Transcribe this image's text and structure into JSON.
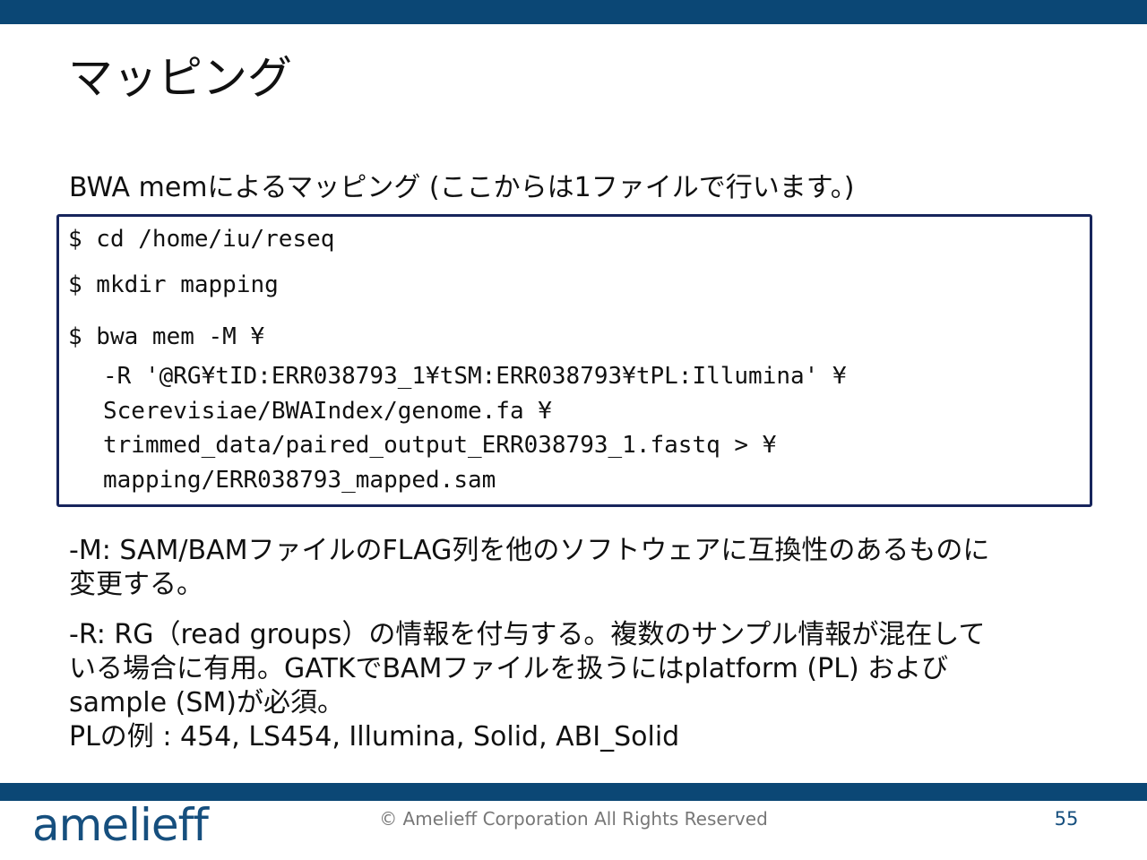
{
  "slide": {
    "title": "マッピング",
    "subtitle": "BWA memによるマッピング (ここからは1ファイルで行います。)"
  },
  "code": {
    "lines": [
      "$ cd /home/iu/reseq",
      "$ mkdir mapping",
      "$ bwa mem -M ¥"
    ],
    "continuation": [
      "-R '@RG¥tID:ERR038793_1¥tSM:ERR038793¥tPL:Illumina' ¥",
      "Scerevisiae/BWAIndex/genome.fa ¥",
      "trimmed_data/paired_output_ERR038793_1.fastq > ¥",
      "mapping/ERR038793_mapped.sam"
    ]
  },
  "notes": {
    "m_option": [
      "-M: SAM/BAMファイルのFLAG列を他のソフトウェアに互換性のあるものに",
      "変更する。"
    ],
    "r_option": [
      "-R: RG（read groups）の情報を付与する。複数のサンプル情報が混在して",
      "いる場合に有用。GATKでBAMファイルを扱うにはplatform (PL) および",
      "sample (SM)が必須。",
      "PLの例 : 454, LS454, Illumina, Solid, ABI_Solid"
    ]
  },
  "footer": {
    "logo": "amelieff",
    "copyright": "© Amelieff Corporation All Rights Reserved",
    "page_number": "55"
  },
  "colors": {
    "brand_blue": "#0b4775",
    "code_border": "#17255c"
  }
}
